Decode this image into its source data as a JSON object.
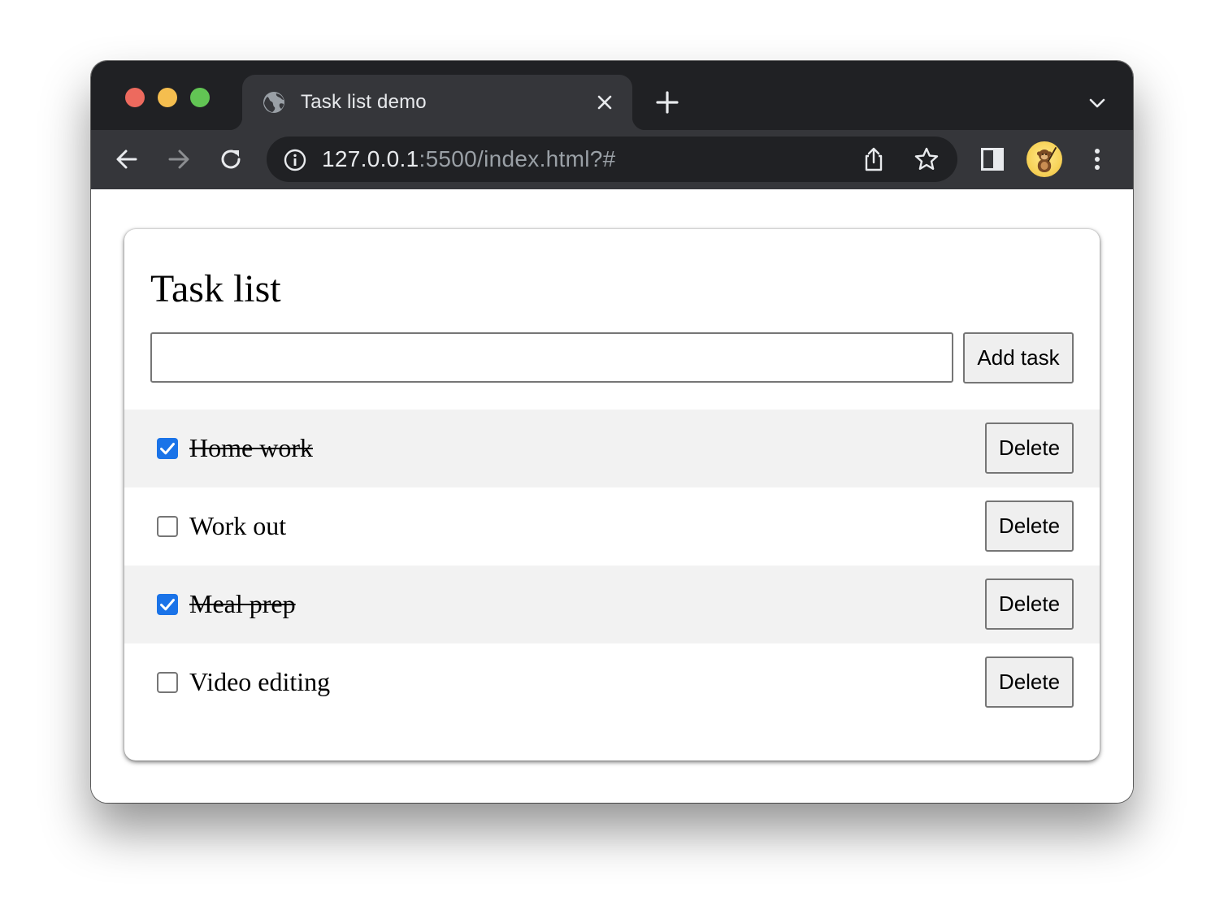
{
  "browser": {
    "tab": {
      "title": "Task list demo",
      "favicon": "globe-icon"
    },
    "address_bar": {
      "host": "127.0.0.1",
      "path": ":5500/index.html?#"
    },
    "colors": {
      "chrome_dark": "#202124",
      "chrome_toolbar": "#35363a",
      "checkbox_accent": "#1a73e8"
    }
  },
  "app": {
    "title": "Task list",
    "new_task": {
      "value": "",
      "placeholder": ""
    },
    "add_button_label": "Add task",
    "tasks": [
      {
        "label": "Home work",
        "done": true,
        "delete_label": "Delete"
      },
      {
        "label": "Work out",
        "done": false,
        "delete_label": "Delete"
      },
      {
        "label": "Meal prep",
        "done": true,
        "delete_label": "Delete"
      },
      {
        "label": "Video editing",
        "done": false,
        "delete_label": "Delete"
      }
    ]
  }
}
